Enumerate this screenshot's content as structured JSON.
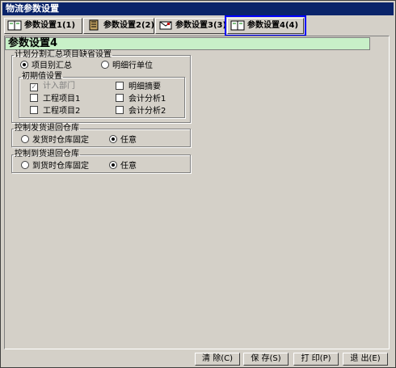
{
  "window": {
    "title": "物流参数设置"
  },
  "tabs": [
    {
      "label": "参数设置1(1)",
      "icon": "book-icon"
    },
    {
      "label": "参数设置2(2)",
      "icon": "notebook-icon"
    },
    {
      "label": "参数设置3(3)",
      "icon": "envelope-icon"
    },
    {
      "label": "参数设置4(4)",
      "icon": "book-icon",
      "active": true
    }
  ],
  "panel": {
    "title": "参数设置4"
  },
  "plan_group": {
    "legend": "计划分割汇总项目缺省设置",
    "option_project_summary": "项目别汇总",
    "option_detail_unit": "明细行单位",
    "init_group": {
      "legend": "初期值设置",
      "items": [
        {
          "label": "计入部门",
          "checked": true,
          "disabled": true
        },
        {
          "label": "明细摘要",
          "checked": false
        },
        {
          "label": "工程项目1",
          "checked": false
        },
        {
          "label": "会计分析1",
          "checked": false
        },
        {
          "label": "工程项目2",
          "checked": false
        },
        {
          "label": "会计分析2",
          "checked": false
        }
      ]
    }
  },
  "ship_group": {
    "legend": "控制发货退回仓库",
    "option_fixed": "发货时仓库固定",
    "option_any": "任意"
  },
  "receive_group": {
    "legend": "控制到货退回仓库",
    "option_fixed": "到货时仓库固定",
    "option_any": "任意"
  },
  "buttons": {
    "clear": "清 除(C)",
    "save": "保 存(S)",
    "print": "打 印(P)",
    "exit": "退 出(E)"
  }
}
